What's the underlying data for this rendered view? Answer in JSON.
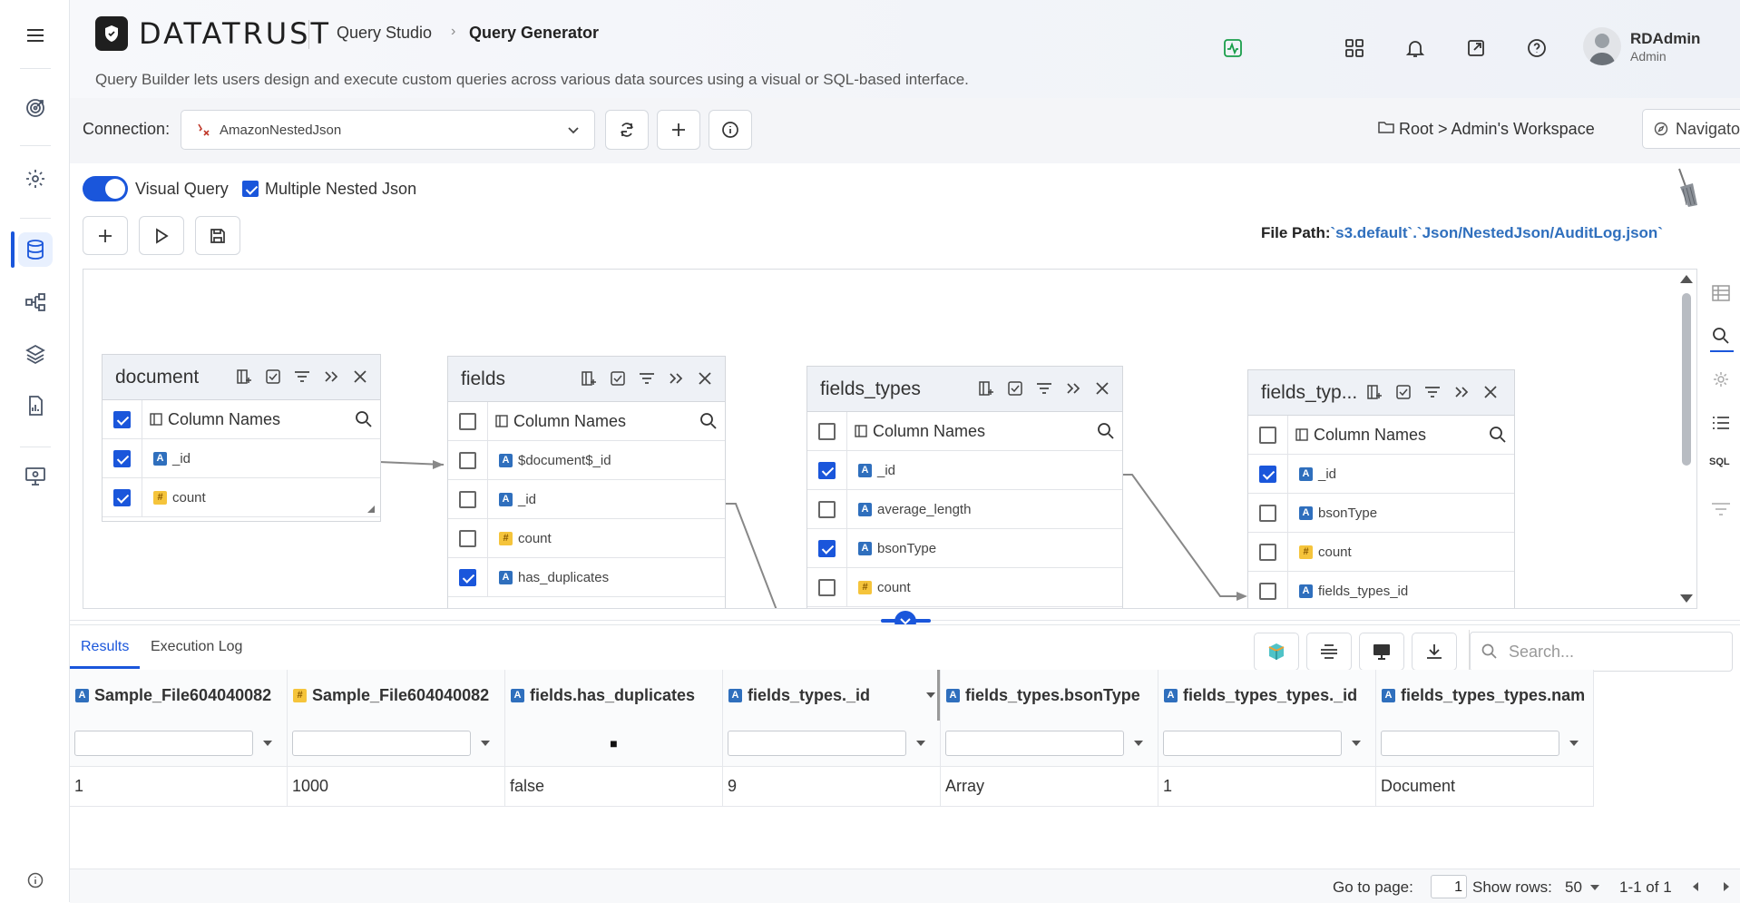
{
  "brand": {
    "name": "DATATRUST"
  },
  "breadcrumb": {
    "parent": "Query Studio",
    "current": "Query Generator"
  },
  "description": "Query Builder lets users design and execute custom queries across various data sources using a visual or SQL-based interface.",
  "user": {
    "name": "RDAdmin",
    "role": "Admin"
  },
  "connection": {
    "label": "Connection:",
    "value": "AmazonNestedJson"
  },
  "workspace": {
    "path": "Root > Admin's Workspace",
    "navigator_label": "Navigator"
  },
  "options": {
    "visual_query_label": "Visual Query",
    "visual_query_on": true,
    "multiple_nested_label": "Multiple Nested Json",
    "multiple_nested_checked": true
  },
  "file_path": {
    "label": "File Path:",
    "value": "`s3.default`.`Json/NestedJson/AuditLog.json`"
  },
  "side_tools": {
    "sql_label": "SQL"
  },
  "tables": [
    {
      "title": "document",
      "column_header": "Column Names",
      "header_checked": true,
      "fields": [
        {
          "name": "_id",
          "type": "A",
          "checked": true
        },
        {
          "name": "count",
          "type": "#",
          "checked": true
        }
      ]
    },
    {
      "title": "fields",
      "column_header": "Column Names",
      "header_checked": false,
      "fields": [
        {
          "name": "$document$_id",
          "type": "A",
          "checked": false
        },
        {
          "name": "_id",
          "type": "A",
          "checked": false
        },
        {
          "name": "count",
          "type": "#",
          "checked": false
        },
        {
          "name": "has_duplicates",
          "type": "A",
          "checked": true
        }
      ]
    },
    {
      "title": "fields_types",
      "column_header": "Column Names",
      "header_checked": false,
      "fields": [
        {
          "name": "_id",
          "type": "A",
          "checked": true
        },
        {
          "name": "average_length",
          "type": "A",
          "checked": false
        },
        {
          "name": "bsonType",
          "type": "A",
          "checked": true
        },
        {
          "name": "count",
          "type": "#",
          "checked": false
        }
      ]
    },
    {
      "title": "fields_typ...",
      "column_header": "Column Names",
      "header_checked": false,
      "fields": [
        {
          "name": "_id",
          "type": "A",
          "checked": true
        },
        {
          "name": "bsonType",
          "type": "A",
          "checked": false
        },
        {
          "name": "count",
          "type": "#",
          "checked": false
        },
        {
          "name": "fields_types_id",
          "type": "A",
          "checked": false
        }
      ]
    }
  ],
  "results": {
    "tabs": [
      {
        "label": "Results",
        "active": true
      },
      {
        "label": "Execution Log",
        "active": false
      }
    ],
    "search_placeholder": "Search...",
    "columns": [
      {
        "type": "A",
        "label": "Sample_File604040082"
      },
      {
        "type": "#",
        "label": "Sample_File604040082"
      },
      {
        "type": "A",
        "label": "fields.has_duplicates"
      },
      {
        "type": "A",
        "label": "fields_types._id"
      },
      {
        "type": "A",
        "label": "fields_types.bsonType"
      },
      {
        "type": "A",
        "label": "fields_types_types._id"
      },
      {
        "type": "A",
        "label": "fields_types_types.nam"
      }
    ],
    "rows": [
      [
        "1",
        "1000",
        "false",
        "9",
        "Array",
        "1",
        "Document"
      ]
    ],
    "filter_bool_placeholder": "■"
  },
  "pagination": {
    "goto_label": "Go to page:",
    "page": "1",
    "show_rows_label": "Show rows:",
    "rows_value": "50",
    "range": "1-1 of 1"
  }
}
